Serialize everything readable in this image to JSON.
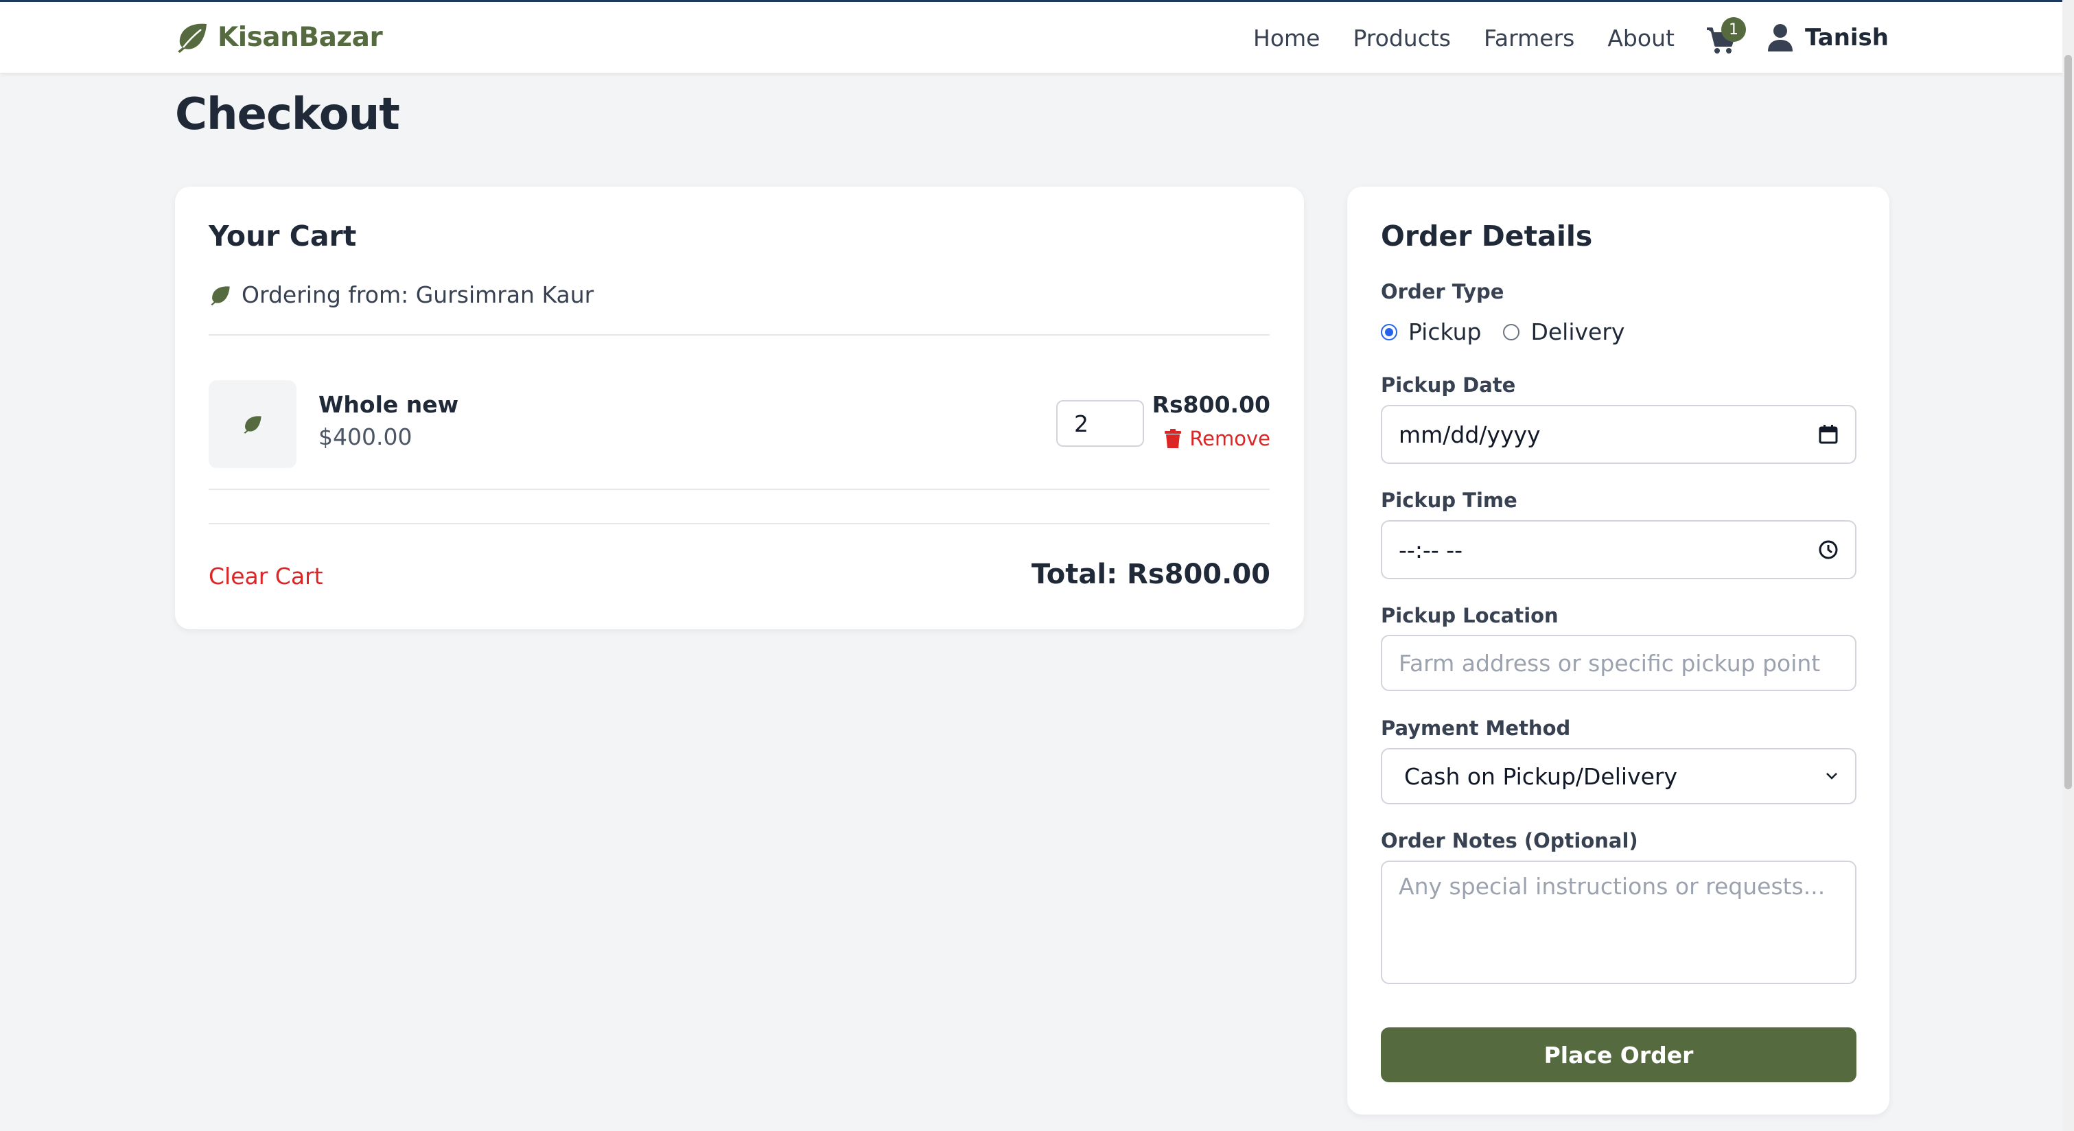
{
  "header": {
    "brand": "KisanBazar",
    "nav": [
      "Home",
      "Products",
      "Farmers",
      "About"
    ],
    "cart_count": "1",
    "user_name": "Tanish"
  },
  "page_title": "Checkout",
  "cart": {
    "title": "Your Cart",
    "ordering_from": "Ordering from: Gursimran Kaur",
    "items": [
      {
        "name": "Whole new",
        "unit_price": "$400.00",
        "quantity": "2",
        "line_total": "Rs800.00",
        "remove_label": "Remove"
      }
    ],
    "clear_label": "Clear Cart",
    "total": "Total: Rs800.00"
  },
  "order": {
    "title": "Order Details",
    "order_type_label": "Order Type",
    "order_types": [
      "Pickup",
      "Delivery"
    ],
    "selected_order_type": "Pickup",
    "pickup_date_label": "Pickup Date",
    "pickup_date_value": "mm/dd/yyyy",
    "pickup_time_label": "Pickup Time",
    "pickup_time_value": "--:-- --",
    "pickup_location_label": "Pickup Location",
    "pickup_location_placeholder": "Farm address or specific pickup point",
    "payment_label": "Payment Method",
    "payment_value": "Cash on Pickup/Delivery",
    "notes_label": "Order Notes (Optional)",
    "notes_placeholder": "Any special instructions or requests...",
    "submit_label": "Place Order"
  },
  "colors": {
    "brand_green": "#556b3f",
    "danger_red": "#dc2626",
    "radio_blue": "#2563eb"
  },
  "icons": [
    "leaf-icon",
    "cart-icon",
    "user-icon",
    "trash-icon",
    "calendar-icon",
    "clock-icon",
    "chevron-down-icon"
  ]
}
